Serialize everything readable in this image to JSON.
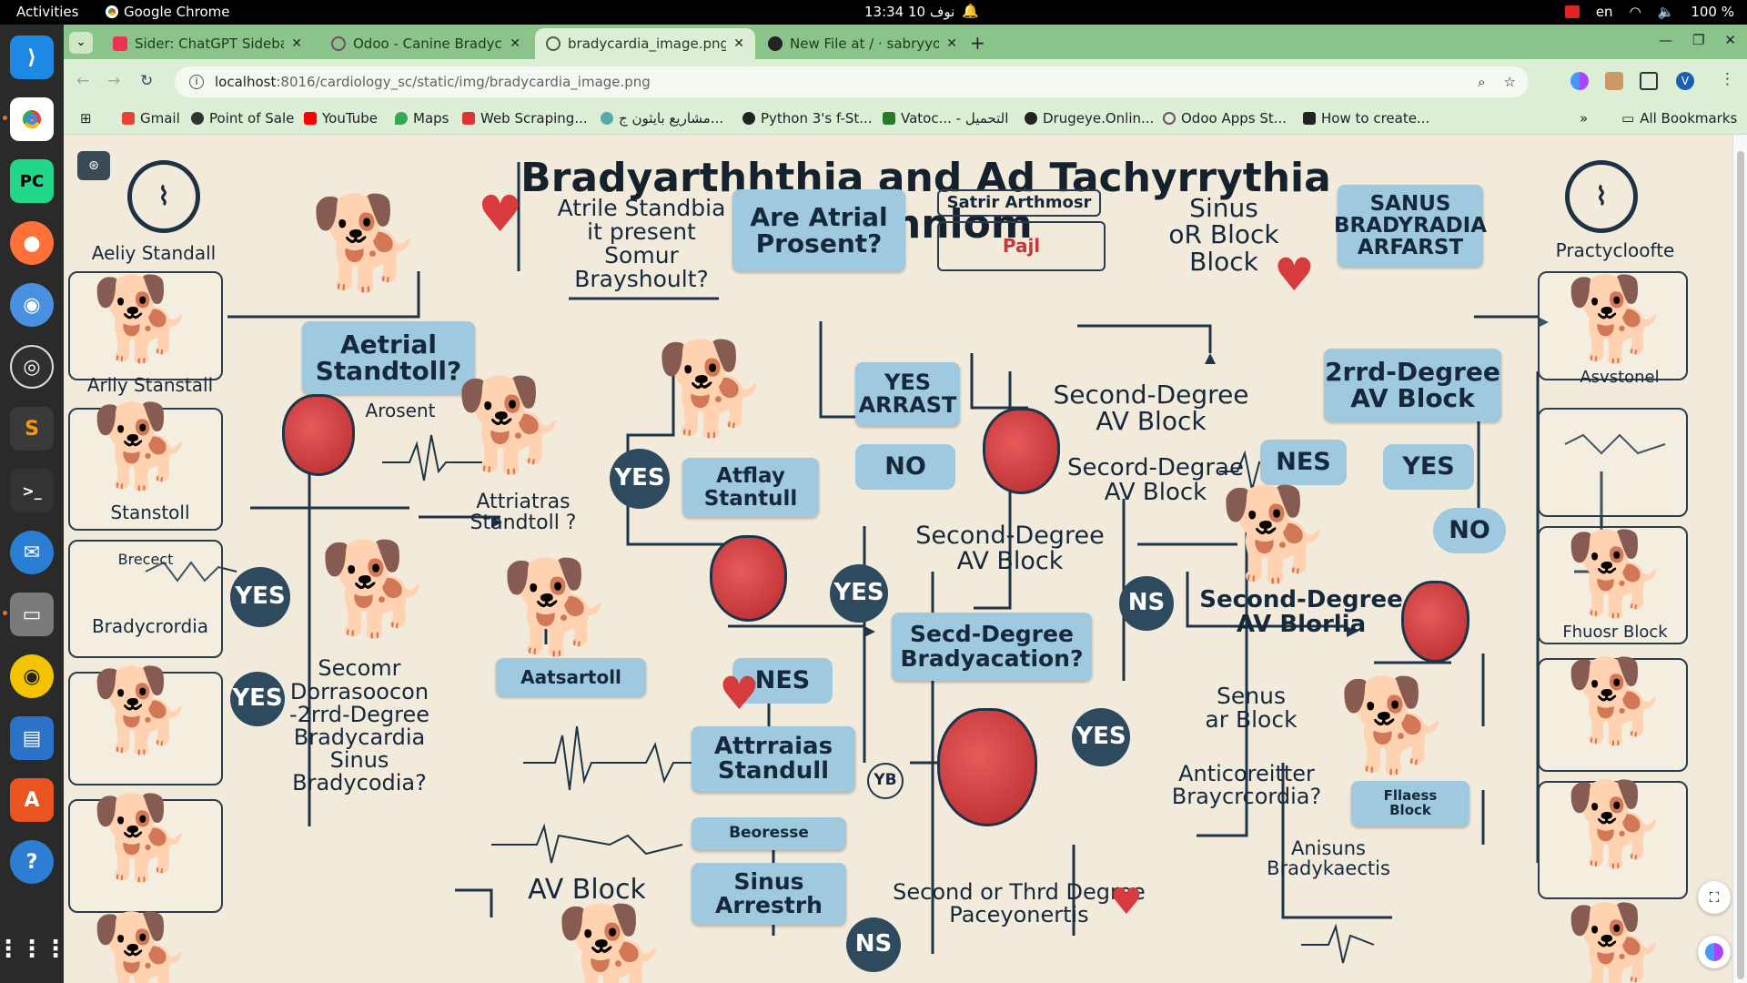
{
  "system": {
    "activities": "Activities",
    "app_name": "Google Chrome",
    "clock": "13:34  نوف 10",
    "lang": "en",
    "battery": "100 %"
  },
  "dock": [
    "vscode-icon",
    "chrome-icon",
    "pycharm-icon",
    "firefox-icon",
    "chromium-icon",
    "obs-icon",
    "sublime-icon",
    "terminal-icon",
    "thunderbird-icon",
    "files-icon",
    "rhythmbox-icon",
    "writer-icon",
    "app-center-icon",
    "help-icon",
    "apps-grid-icon"
  ],
  "tabs": [
    {
      "title": "Sider: ChatGPT Sidebar +",
      "active": false
    },
    {
      "title": "Odoo - Canine Bradycardia",
      "active": false
    },
    {
      "title": "bradycardia_image.png (",
      "active": true
    },
    {
      "title": "New File at / · sabryyoussef",
      "active": false
    }
  ],
  "address": {
    "host": "localhost",
    "path": ":8016/cardiology_sc/static/img/bradycardia_image.png",
    "profile_initial": "V"
  },
  "bookmarks": [
    {
      "label": "Gmail",
      "color": "#ea4335"
    },
    {
      "label": "Point of Sale",
      "color": "#333333"
    },
    {
      "label": "YouTube",
      "color": "#ff0000"
    },
    {
      "label": "Maps",
      "color": "#34a853"
    },
    {
      "label": "Web Scraping...",
      "color": "#d33"
    },
    {
      "label": "مشاريع بايثون ج...",
      "color": "#5aa"
    },
    {
      "label": "Python 3's f-St...",
      "color": "#222"
    },
    {
      "label": "Vatoc... - التحميل",
      "color": "#2a7a2a"
    },
    {
      "label": "Drugeye.Onlin...",
      "color": "#222"
    },
    {
      "label": "Odoo Apps St...",
      "color": "#714b67"
    },
    {
      "label": "How to create...",
      "color": "#222"
    }
  ],
  "all_bookmarks": "All Bookmarks",
  "image": {
    "title": "Bradyarthhthia and Ad Tachyrrythia Alghnlom",
    "left_col": [
      "Aeliy Standall",
      "Arlly Stanstall",
      "Stanstoll",
      "Bradycrordia"
    ],
    "left_small": "Brecect",
    "right_col": [
      "Practycloofte",
      "Asvstonel",
      "Fhuosr Block"
    ],
    "nodes": {
      "atrial_standbia": "Atrile Standbia\nit present\nSomur\nBrayshoult?",
      "are_atrial": "Are Atrial\nProsent?",
      "satrir": "Satrir Arthmosr",
      "pajl": "Pajl",
      "sinus_block": "Sinus\noR Block\nBlock",
      "sanus_brady": "SANUS\nBRADYRADIA\nARFARST",
      "aetrial_standtoll": "Aetrial\nStandtoll?",
      "arosent": "Arosent",
      "atriatras": "Attriatras\nStandtoll ?",
      "yes_arrast": "YES\nARRAST",
      "second_degree_1": "Second-Degree\nAV Block",
      "second_degree_2": "Secord-Degrae\nAV Block",
      "third_degree": "2rrd-Degree\nAV Block",
      "atflay": "Atflay\nStantull",
      "no_1": "NO",
      "nes_1": "NES",
      "yes_right": "YES",
      "no_right": "NO",
      "second_degree_3": "Second-Degree\nAV Block",
      "second_degree_4": "Second-Degree\nAV Blorlia",
      "seced": "Secd-Degree\nBradyacation?",
      "ns_1": "NS",
      "ns_2": "NS",
      "aatsartoll": "Aatsartoll",
      "nes_2": "NES",
      "secomr": "Secomr\nDorrasoocon\n-2rrd-Degree\nBradycardia\nSinus\nBradycodia?",
      "attrraias": "Attrraias\nStandull",
      "beorese": "Beoresse",
      "sinus_arrest": "Sinus\nArrestrh",
      "av_block": "AV Block",
      "second_or_third": "Second or Thrd Degree\nPaceyonertis",
      "senus": "Senus\nar Block",
      "anticoreitter": "Anticoreitter\nBraycrcordia?",
      "flaess": "Fllaess\nBlock",
      "anisuns": "Anisuns\nBradykaectis",
      "yes_1": "YES",
      "yes_2": "YES",
      "yes_3": "YES",
      "yes_4": "YES",
      "yes_5": "YES",
      "yb": "YB"
    }
  }
}
